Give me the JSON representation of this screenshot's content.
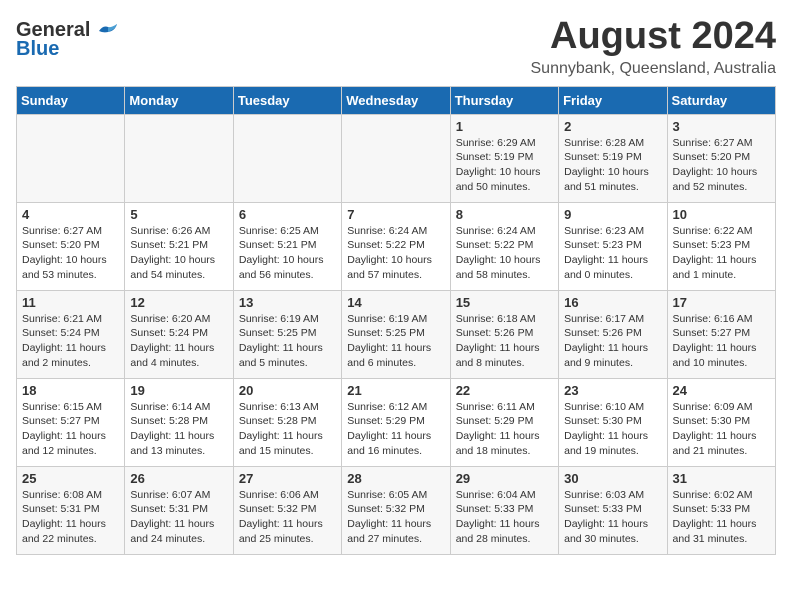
{
  "header": {
    "logo_general": "General",
    "logo_blue": "Blue",
    "month": "August 2024",
    "location": "Sunnybank, Queensland, Australia"
  },
  "days_of_week": [
    "Sunday",
    "Monday",
    "Tuesday",
    "Wednesday",
    "Thursday",
    "Friday",
    "Saturday"
  ],
  "weeks": [
    [
      {
        "day": "",
        "info": ""
      },
      {
        "day": "",
        "info": ""
      },
      {
        "day": "",
        "info": ""
      },
      {
        "day": "",
        "info": ""
      },
      {
        "day": "1",
        "info": "Sunrise: 6:29 AM\nSunset: 5:19 PM\nDaylight: 10 hours\nand 50 minutes."
      },
      {
        "day": "2",
        "info": "Sunrise: 6:28 AM\nSunset: 5:19 PM\nDaylight: 10 hours\nand 51 minutes."
      },
      {
        "day": "3",
        "info": "Sunrise: 6:27 AM\nSunset: 5:20 PM\nDaylight: 10 hours\nand 52 minutes."
      }
    ],
    [
      {
        "day": "4",
        "info": "Sunrise: 6:27 AM\nSunset: 5:20 PM\nDaylight: 10 hours\nand 53 minutes."
      },
      {
        "day": "5",
        "info": "Sunrise: 6:26 AM\nSunset: 5:21 PM\nDaylight: 10 hours\nand 54 minutes."
      },
      {
        "day": "6",
        "info": "Sunrise: 6:25 AM\nSunset: 5:21 PM\nDaylight: 10 hours\nand 56 minutes."
      },
      {
        "day": "7",
        "info": "Sunrise: 6:24 AM\nSunset: 5:22 PM\nDaylight: 10 hours\nand 57 minutes."
      },
      {
        "day": "8",
        "info": "Sunrise: 6:24 AM\nSunset: 5:22 PM\nDaylight: 10 hours\nand 58 minutes."
      },
      {
        "day": "9",
        "info": "Sunrise: 6:23 AM\nSunset: 5:23 PM\nDaylight: 11 hours\nand 0 minutes."
      },
      {
        "day": "10",
        "info": "Sunrise: 6:22 AM\nSunset: 5:23 PM\nDaylight: 11 hours\nand 1 minute."
      }
    ],
    [
      {
        "day": "11",
        "info": "Sunrise: 6:21 AM\nSunset: 5:24 PM\nDaylight: 11 hours\nand 2 minutes."
      },
      {
        "day": "12",
        "info": "Sunrise: 6:20 AM\nSunset: 5:24 PM\nDaylight: 11 hours\nand 4 minutes."
      },
      {
        "day": "13",
        "info": "Sunrise: 6:19 AM\nSunset: 5:25 PM\nDaylight: 11 hours\nand 5 minutes."
      },
      {
        "day": "14",
        "info": "Sunrise: 6:19 AM\nSunset: 5:25 PM\nDaylight: 11 hours\nand 6 minutes."
      },
      {
        "day": "15",
        "info": "Sunrise: 6:18 AM\nSunset: 5:26 PM\nDaylight: 11 hours\nand 8 minutes."
      },
      {
        "day": "16",
        "info": "Sunrise: 6:17 AM\nSunset: 5:26 PM\nDaylight: 11 hours\nand 9 minutes."
      },
      {
        "day": "17",
        "info": "Sunrise: 6:16 AM\nSunset: 5:27 PM\nDaylight: 11 hours\nand 10 minutes."
      }
    ],
    [
      {
        "day": "18",
        "info": "Sunrise: 6:15 AM\nSunset: 5:27 PM\nDaylight: 11 hours\nand 12 minutes."
      },
      {
        "day": "19",
        "info": "Sunrise: 6:14 AM\nSunset: 5:28 PM\nDaylight: 11 hours\nand 13 minutes."
      },
      {
        "day": "20",
        "info": "Sunrise: 6:13 AM\nSunset: 5:28 PM\nDaylight: 11 hours\nand 15 minutes."
      },
      {
        "day": "21",
        "info": "Sunrise: 6:12 AM\nSunset: 5:29 PM\nDaylight: 11 hours\nand 16 minutes."
      },
      {
        "day": "22",
        "info": "Sunrise: 6:11 AM\nSunset: 5:29 PM\nDaylight: 11 hours\nand 18 minutes."
      },
      {
        "day": "23",
        "info": "Sunrise: 6:10 AM\nSunset: 5:30 PM\nDaylight: 11 hours\nand 19 minutes."
      },
      {
        "day": "24",
        "info": "Sunrise: 6:09 AM\nSunset: 5:30 PM\nDaylight: 11 hours\nand 21 minutes."
      }
    ],
    [
      {
        "day": "25",
        "info": "Sunrise: 6:08 AM\nSunset: 5:31 PM\nDaylight: 11 hours\nand 22 minutes."
      },
      {
        "day": "26",
        "info": "Sunrise: 6:07 AM\nSunset: 5:31 PM\nDaylight: 11 hours\nand 24 minutes."
      },
      {
        "day": "27",
        "info": "Sunrise: 6:06 AM\nSunset: 5:32 PM\nDaylight: 11 hours\nand 25 minutes."
      },
      {
        "day": "28",
        "info": "Sunrise: 6:05 AM\nSunset: 5:32 PM\nDaylight: 11 hours\nand 27 minutes."
      },
      {
        "day": "29",
        "info": "Sunrise: 6:04 AM\nSunset: 5:33 PM\nDaylight: 11 hours\nand 28 minutes."
      },
      {
        "day": "30",
        "info": "Sunrise: 6:03 AM\nSunset: 5:33 PM\nDaylight: 11 hours\nand 30 minutes."
      },
      {
        "day": "31",
        "info": "Sunrise: 6:02 AM\nSunset: 5:33 PM\nDaylight: 11 hours\nand 31 minutes."
      }
    ]
  ]
}
